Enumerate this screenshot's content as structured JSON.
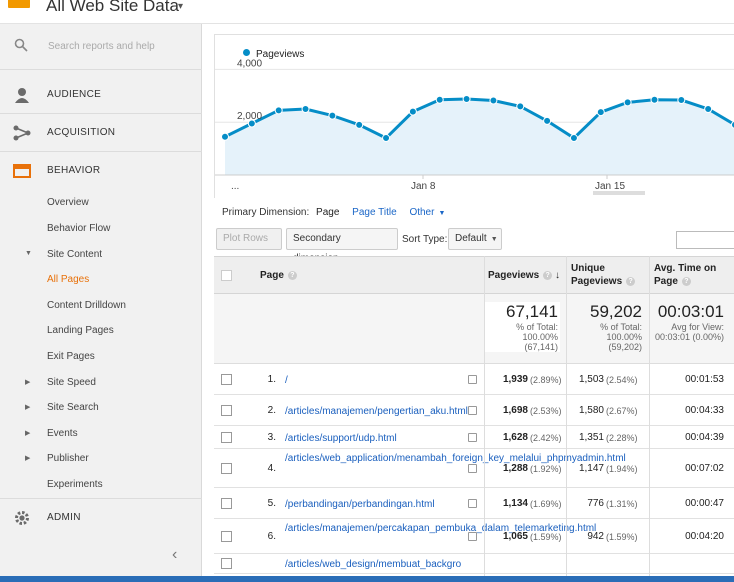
{
  "header": {
    "property": "All Web Site Data",
    "caret": "▾"
  },
  "sidebar": {
    "search_placeholder": "Search reports and help",
    "sections": [
      {
        "label": "AUDIENCE",
        "icon": "person-icon"
      },
      {
        "label": "ACQUISITION",
        "icon": "acquisition-icon"
      },
      {
        "label": "BEHAVIOR",
        "icon": "behavior-icon"
      }
    ],
    "behavior_items": [
      {
        "label": "Overview"
      },
      {
        "label": "Behavior Flow"
      },
      {
        "label": "Site Content",
        "expanded": true
      },
      {
        "label": "All Pages",
        "active": true
      },
      {
        "label": "Content Drilldown"
      },
      {
        "label": "Landing Pages"
      },
      {
        "label": "Exit Pages"
      },
      {
        "label": "Site Speed"
      },
      {
        "label": "Site Search"
      },
      {
        "label": "Events"
      },
      {
        "label": "Publisher"
      },
      {
        "label": "Experiments"
      }
    ],
    "admin": "ADMIN",
    "collapse": "‹"
  },
  "chart_data": {
    "type": "area",
    "series": [
      {
        "name": "Pageviews",
        "color": "#058dc7",
        "values": [
          1450,
          1950,
          2450,
          2500,
          2250,
          1900,
          1400,
          2400,
          2850,
          2880,
          2820,
          2600,
          2050,
          1400,
          2380,
          2750,
          2850,
          2840,
          2500,
          1900
        ]
      }
    ],
    "x_tick_labels": [
      "...",
      "Jan 8",
      "Jan 15"
    ],
    "y_tick_labels": [
      "4,000",
      "2,000"
    ],
    "ylim": [
      0,
      4500
    ],
    "grid": true
  },
  "dimensions": {
    "label": "Primary Dimension:",
    "current": "Page",
    "options": [
      "Page Title",
      "Other"
    ]
  },
  "toolbar": {
    "plot_rows": "Plot Rows",
    "secondary": "Secondary dimension",
    "sort_label": "Sort Type:",
    "sort_value": "Default"
  },
  "table": {
    "headers": {
      "page": "Page",
      "pageviews": "Pageviews",
      "unique1": "Unique",
      "unique2": "Pageviews",
      "avg1": "Avg. Time on",
      "avg2": "Page"
    },
    "totals": {
      "pageviews": "67,141",
      "pv_sub1": "% of Total:",
      "pv_sub2": "100.00%",
      "pv_sub3": "(67,141)",
      "unique": "59,202",
      "u_sub1": "% of Total:",
      "u_sub2": "100.00%",
      "u_sub3": "(59,202)",
      "avg": "00:03:01",
      "a_sub1": "Avg for View:",
      "a_sub2": "00:03:01 (0.00%)"
    },
    "rows": [
      {
        "num": "1.",
        "page": "/",
        "pv": "1,939",
        "pvpct": "(2.89%)",
        "upv": "1,503",
        "upvpct": "(2.54%)",
        "avg": "00:01:53"
      },
      {
        "num": "2.",
        "page": "/articles/manajemen/pengertian_aku.html",
        "pv": "1,698",
        "pvpct": "(2.53%)",
        "upv": "1,580",
        "upvpct": "(2.67%)",
        "avg": "00:04:33"
      },
      {
        "num": "3.",
        "page": "/articles/support/udp.html",
        "pv": "1,628",
        "pvpct": "(2.42%)",
        "upv": "1,351",
        "upvpct": "(2.28%)",
        "avg": "00:04:39"
      },
      {
        "num": "4.",
        "page": "/articles/web_application/menambah_foreign_key_melalui_phpmyadmin.html",
        "pv": "1,288",
        "pvpct": "(1.92%)",
        "upv": "1,147",
        "upvpct": "(1.94%)",
        "avg": "00:07:02"
      },
      {
        "num": "5.",
        "page": "/perbandingan/perbandingan.html",
        "pv": "1,134",
        "pvpct": "(1.69%)",
        "upv": "776",
        "upvpct": "(1.31%)",
        "avg": "00:00:47"
      },
      {
        "num": "6.",
        "page": "/articles/manajemen/percakapan_pembuka_dalam_telemarketing.html",
        "pv": "1,065",
        "pvpct": "(1.59%)",
        "upv": "942",
        "upvpct": "(1.59%)",
        "avg": "00:04:20"
      },
      {
        "num": "",
        "page": "/articles/web_design/membuat_backgro",
        "pv": "",
        "pvpct": "",
        "upv": "",
        "upvpct": "",
        "avg": ""
      }
    ]
  }
}
